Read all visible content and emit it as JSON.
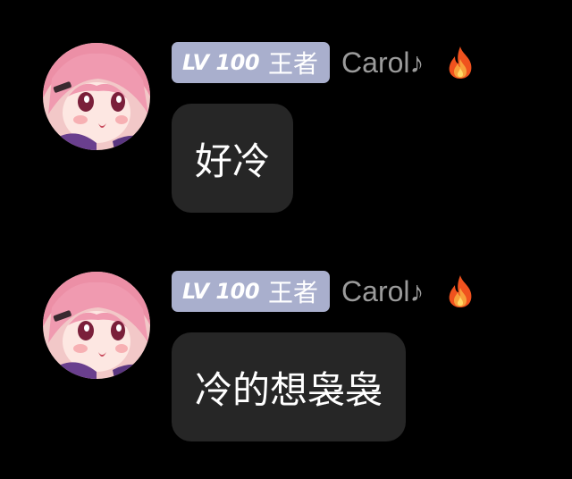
{
  "messages": [
    {
      "level": "LV 100",
      "level_title": "王者",
      "username": "Carol♪",
      "text": "好冷",
      "avatar_icon": "anime-girl-avatar-icon",
      "badge_icon": "fire-icon"
    },
    {
      "level": "LV 100",
      "level_title": "王者",
      "username": "Carol♪",
      "text": "冷的想袅袅",
      "avatar_icon": "anime-girl-avatar-icon",
      "badge_icon": "fire-icon"
    }
  ],
  "colors": {
    "background": "#000000",
    "bubble": "#262626",
    "level_badge": "#a9afcd",
    "username": "#9b9b9b",
    "message_text": "#ffffff"
  }
}
